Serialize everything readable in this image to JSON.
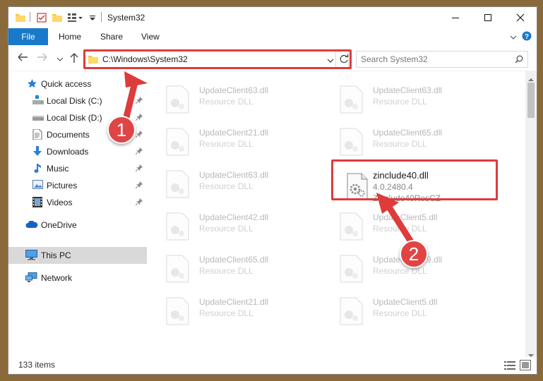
{
  "window": {
    "title": "System32"
  },
  "ribbon": {
    "file": "File",
    "home": "Home",
    "share": "Share",
    "view": "View"
  },
  "address": {
    "path": "C:\\Windows\\System32"
  },
  "search": {
    "placeholder": "Search System32"
  },
  "nav": {
    "quick_access": "Quick access",
    "local_c": "Local Disk (C:)",
    "local_d": "Local Disk (D:)",
    "documents": "Documents",
    "downloads": "Downloads",
    "music": "Music",
    "pictures": "Pictures",
    "videos": "Videos",
    "onedrive": "OneDrive",
    "this_pc": "This PC",
    "network": "Network"
  },
  "files": {
    "left": [
      {
        "name": "UpdateClient63.dll",
        "desc": "Resource DLL"
      },
      {
        "name": "UpdateClient21.dll",
        "desc": "Resource DLL"
      },
      {
        "name": "UpdateClient63.dll",
        "desc": "Resource DLL"
      },
      {
        "name": "UpdateClient42.dll",
        "desc": "Resource DLL"
      },
      {
        "name": "UpdateClient65.dll",
        "desc": "Resource DLL"
      },
      {
        "name": "UpdateClient21.dll",
        "desc": "Resource DLL"
      }
    ],
    "right": [
      {
        "name": "UpdateClient63.dll",
        "desc": "Resource DLL"
      },
      {
        "name": "UpdateClient65.dll",
        "desc": "Resource DLL"
      },
      {
        "name": "UpdateClient5.dll",
        "desc": "Resource DLL"
      },
      {
        "name": "UpdateClient19.dll",
        "desc": "Resource DLL"
      },
      {
        "name": "UpdateClient5.dll",
        "desc": "Resource DLL"
      }
    ],
    "highlight": {
      "name": "zinclude40.dll",
      "version": "4.0.2480.4",
      "desc": "Zinclude40ResCZ"
    }
  },
  "status": {
    "count": "133 items"
  },
  "callouts": {
    "one": "1",
    "two": "2"
  },
  "colors": {
    "accent": "#1979ca",
    "callout": "#e04545"
  }
}
